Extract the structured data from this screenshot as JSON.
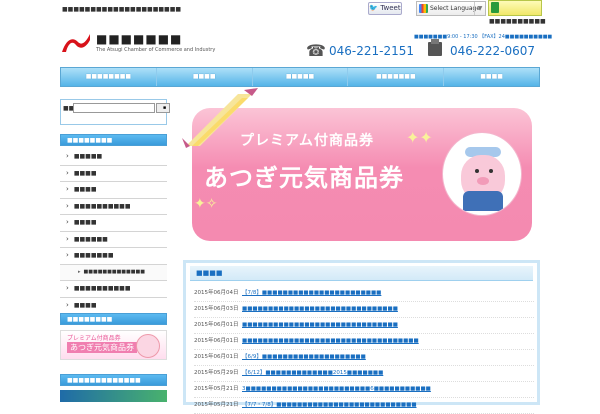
{
  "header": {
    "tagline": "■■■■■■■■■■■■■■■■■■■■■",
    "tweet_label": "Tweet",
    "language_label": "Select Language",
    "accessibility_label": "■■■■■■■■■■",
    "logo_title": "■■■■■■■",
    "logo_subtitle": "The Atsugi Chamber of Commerce and Industry",
    "hours": "■■■■■■■9:00 - 17:30 【FAX】24■■■■■■■■■■",
    "phone": "046-221-2151",
    "fax": "046-222-0607"
  },
  "nav": {
    "items": [
      "■■■■■■■■",
      "■■■■",
      "■■■■■",
      "■■■■■■■",
      "■■■■"
    ]
  },
  "sidebar": {
    "search_label": "■■:",
    "search_placeholder": "",
    "search_button": "■",
    "menu_heading": "■■■■■■■■",
    "menu_items": [
      "■■■■■",
      "■■■■",
      "■■■■",
      "■■■■■■■■■■",
      "■■■■",
      "■■■■■■",
      "■■■■■■■"
    ],
    "submenu_item": "■■■■■■■■■■■■■",
    "menu_items_after": [
      "■■■■■■■■■■",
      "■■■■"
    ],
    "promo_heading": "■■■■■■■■",
    "promo_line1": "プレミアム付商品券",
    "promo_line2": "あつぎ元気商品券",
    "links_heading": "■■■■■■■■■■■■■"
  },
  "banner": {
    "line1": "プレミアム付商品券",
    "line2": "あつぎ元気商品券"
  },
  "news": {
    "title": "■■■■",
    "items": [
      {
        "date": "2015年06月04日",
        "text": "【7/8】■■■■■■■■■■■■■■■■■■■■■■■"
      },
      {
        "date": "2015年06月03日",
        "text": "■■■■■■■■■■■■■■■■■■■■■■■■■■■■■■"
      },
      {
        "date": "2015年06月01日",
        "text": "■■■■■■■■■■■■■■■■■■■■■■■■■■■■■■"
      },
      {
        "date": "2015年06月01日",
        "text": "■■■■■■■■■■■■■■■■■■■■■■■■■■■■■■■■■■"
      },
      {
        "date": "2015年06月01日",
        "text": "【6/9】■■■■■■■■■■■■■■■■■■■■"
      },
      {
        "date": "2015年05月29日",
        "text": "【6/12】■■■■■■■■■■■■■2015■■■■■■■"
      },
      {
        "date": "2015年05月21日",
        "text": "3■■■■■■■■■■■■■■■■■■■■■■■■6■■■■■■■■■■■"
      },
      {
        "date": "2015年05月21日",
        "text": "【7/7・7/8】■■■■■■■■■■■■■■■■■■■■■■■■■■■"
      }
    ]
  },
  "colors": {
    "nav": "#55b4e8",
    "accent": "#1a6fc1",
    "banner_pink": "#f58cb2"
  }
}
